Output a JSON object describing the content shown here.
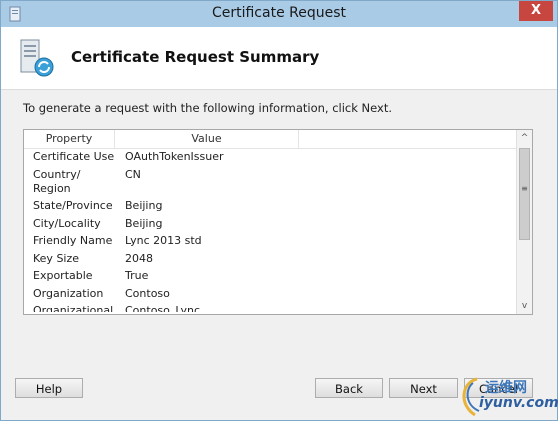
{
  "window": {
    "title": "Certificate Request",
    "close_glyph": "X"
  },
  "header": {
    "title": "Certificate Request Summary"
  },
  "instruction": "To generate a request with the following information, click Next.",
  "list": {
    "columns": [
      "Property",
      "Value"
    ],
    "rows": [
      {
        "property": "Certificate Use",
        "value": "OAuthTokenIssuer"
      },
      {
        "property": "Country/\nRegion",
        "value": "CN"
      },
      {
        "property": "State/Province",
        "value": "Beijing"
      },
      {
        "property": "City/Locality",
        "value": "Beijing"
      },
      {
        "property": "Friendly Name",
        "value": "Lync 2013 std"
      },
      {
        "property": "Key Size",
        "value": "2048"
      },
      {
        "property": "Exportable",
        "value": "True"
      },
      {
        "property": "Organization",
        "value": "Contoso"
      },
      {
        "property": "Organizational",
        "value": "Contoso_Lync"
      }
    ]
  },
  "scrollbar": {
    "up_glyph": "^",
    "down_glyph": "v",
    "grip_glyph": "≡"
  },
  "buttons": {
    "help": "Help",
    "back": "Back",
    "next": "Next",
    "cancel": "Cancel"
  },
  "watermark": {
    "chinese": "运维网",
    "url": "iyunv.com"
  },
  "colors": {
    "titlebar": "#a9cbe6",
    "close": "#c7463f"
  }
}
